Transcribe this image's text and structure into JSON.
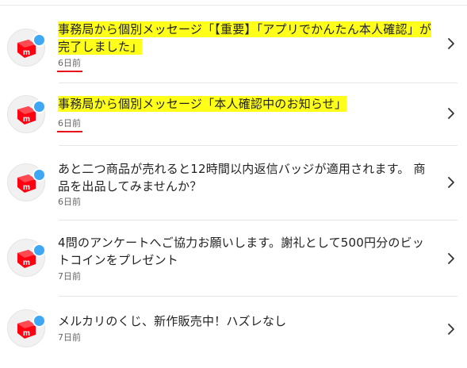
{
  "notifications": [
    {
      "message": "事務局から個別メッセージ「【重要】「アプリでかんたん本人確認」が完了しました」",
      "time": "6日前",
      "highlighted": true,
      "unread": true
    },
    {
      "message": "事務局から個別メッセージ「本人確認中のお知らせ」",
      "time": "6日前",
      "highlighted": true,
      "unread": true
    },
    {
      "message": "あと二つ商品が売れると12時間以内返信バッジが適用されます。 商品を出品してみませんか？",
      "time": "6日前",
      "highlighted": false,
      "unread": true
    },
    {
      "message": "4問のアンケートへご協力お願いします。謝礼として500円分のビットコインをプレゼント",
      "time": "7日前",
      "highlighted": false,
      "unread": true
    },
    {
      "message": "メルカリのくじ、新作販売中！ハズレなし",
      "time": "7日前",
      "highlighted": false,
      "unread": true
    }
  ],
  "colors": {
    "highlight": "#ffff1a",
    "underline": "#e8101a",
    "brand_red": "#ff0211",
    "unread_dot": "#3ea8f5"
  },
  "icons": {
    "avatar": "mercari-logo-icon",
    "unread": "unread-dot-icon",
    "chevron": "chevron-right-icon"
  }
}
